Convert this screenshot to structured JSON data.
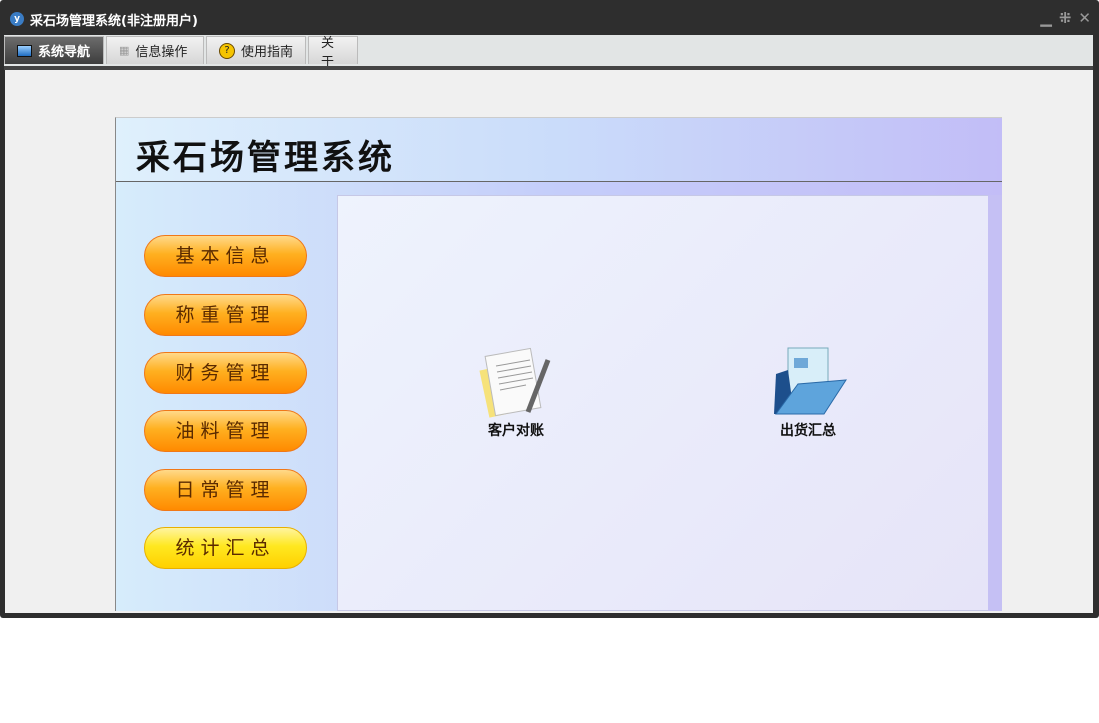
{
  "window": {
    "title": "采石场管理系统(非注册用户)",
    "logo_text": "y",
    "controls": [
      "minimize",
      "restore",
      "close"
    ]
  },
  "tabs": [
    {
      "label": "系统导航",
      "icon": "monitor-icon",
      "active": true
    },
    {
      "label": "信息操作",
      "icon": "grid-icon"
    },
    {
      "label": "使用指南",
      "icon": "help-icon"
    },
    {
      "label": "关于"
    }
  ],
  "app": {
    "title": "采石场管理系统",
    "nav": [
      "基本信息",
      "称重管理",
      "财务管理",
      "油料管理",
      "日常管理",
      "统计汇总"
    ],
    "items": [
      {
        "label": "客户对账",
        "icon": "document-pen-icon"
      },
      {
        "label": "出货汇总",
        "icon": "folder-document-icon"
      }
    ]
  }
}
